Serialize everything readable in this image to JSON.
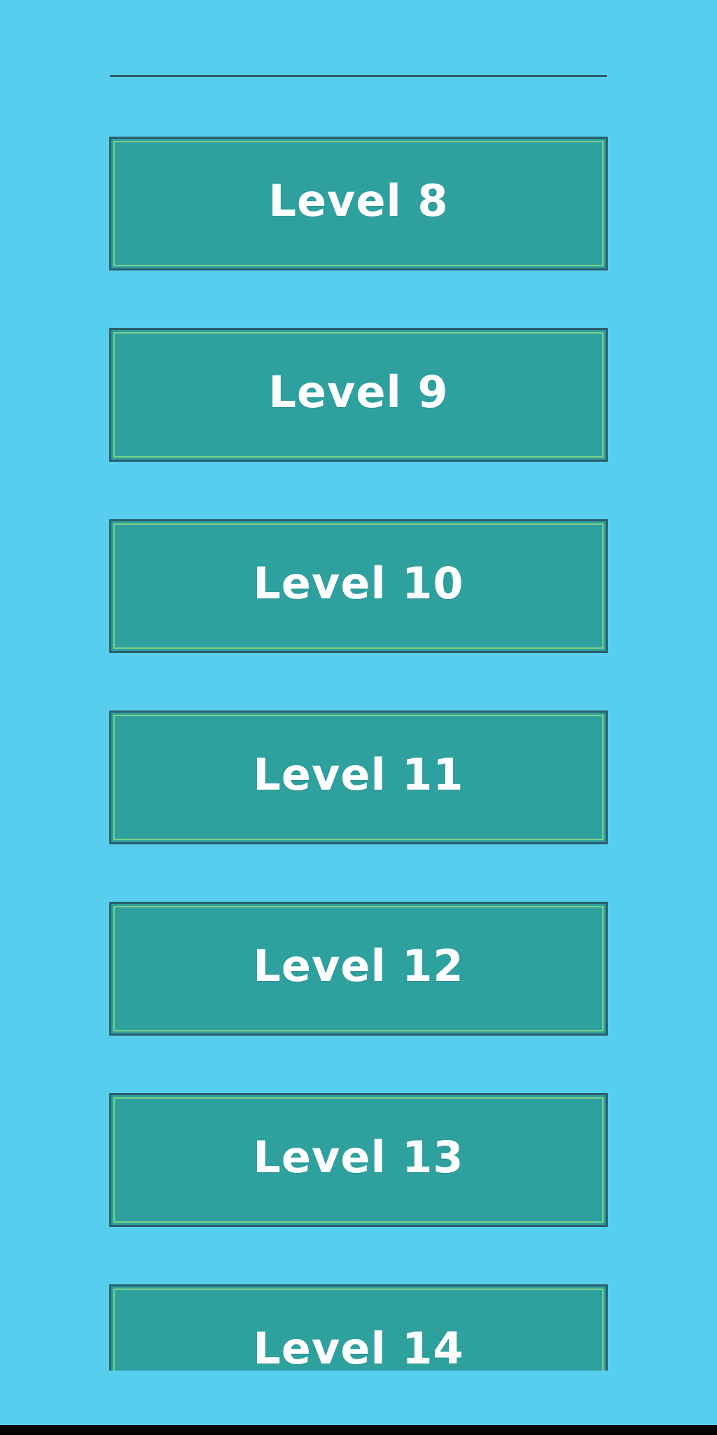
{
  "colors": {
    "background": "#58CEEE",
    "button_fill": "#2EA09E",
    "button_border": "#2B5D6B",
    "button_inner_border": "#7CCF86",
    "label": "#FFFFFF"
  },
  "levels": [
    {
      "label": "Level 8"
    },
    {
      "label": "Level 9"
    },
    {
      "label": "Level 10"
    },
    {
      "label": "Level 11"
    },
    {
      "label": "Level 12"
    },
    {
      "label": "Level 13"
    },
    {
      "label": "Level 14"
    }
  ]
}
